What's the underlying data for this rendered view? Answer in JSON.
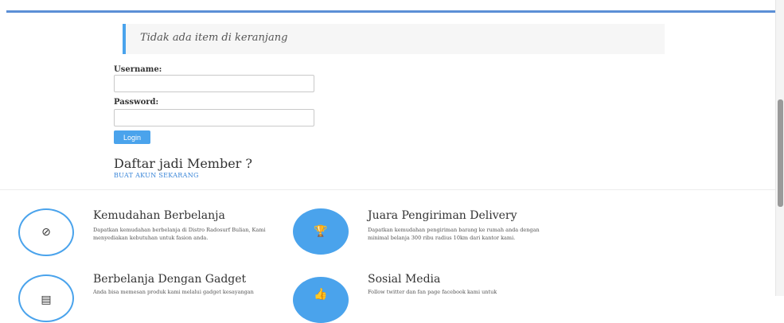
{
  "cart": {
    "empty_message": "Tidak ada item di keranjang"
  },
  "login": {
    "username_label": "Username:",
    "password_label": "Password:",
    "username_value": "",
    "password_value": "",
    "login_button": "Login"
  },
  "member": {
    "title": "Daftar jadi Member ?",
    "link": "BUAT AKUN SEKARANG"
  },
  "features": [
    {
      "title": "Kemudahan Berbelanja",
      "icon": "check-circle-icon",
      "description": "Dapatkan kemudahan berbelanja di Distro Radosurf Bulian, Kami menyediakan kebutuhan untuk fasion anda."
    },
    {
      "title": "Juara Pengiriman Delivery",
      "icon": "trophy-icon",
      "description": "Dapatkan kemudahan pengiriman barang ke rumah anda dengan minimal belanja 300 ribu radius 10km dari kantor kami."
    },
    {
      "title": "Berbelanja Dengan Gadget",
      "icon": "tablet-icon",
      "description": "Anda bisa memesan produk kami melalui gadget kesayangan"
    },
    {
      "title": "Sosial Media",
      "icon": "thumbs-up-icon",
      "description": "Follow twitter dan fan page facebook kami untuk"
    }
  ],
  "colors": {
    "accent": "#4aa3ec",
    "topbar": "#5b8fd6"
  }
}
